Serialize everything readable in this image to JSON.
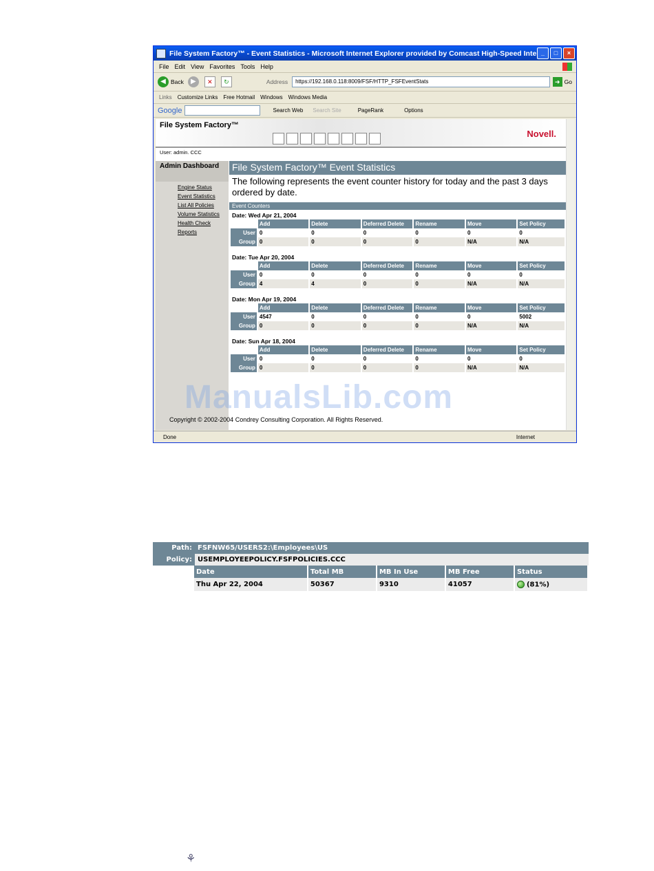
{
  "window": {
    "title": "File System Factory™ - Event Statistics - Microsoft Internet Explorer provided by Comcast High-Speed Internet",
    "menu": [
      "File",
      "Edit",
      "View",
      "Favorites",
      "Tools",
      "Help"
    ],
    "back_label": "Back",
    "address_label": "Address",
    "address_value": "https://192.168.0.118:8009/FSF/HTTP_FSFEventStats",
    "go_label": "Go",
    "links_label": "Links",
    "links": [
      "Customize Links",
      "Free Hotmail",
      "Windows",
      "Windows Media"
    ],
    "google_label": "Google",
    "google_items": [
      "Search Web",
      "Search Site",
      "PageRank",
      "Options"
    ],
    "status_left": "Done",
    "status_right": "Internet"
  },
  "app": {
    "header_title": "File System Factory™",
    "brand": "Novell.",
    "user_line": "User: admin. CCC",
    "side_title": "Admin Dashboard",
    "nav": [
      "Engine Status",
      "Event Statistics",
      "List All Policies",
      "Volume Statistics",
      "Health Check",
      "Reports"
    ],
    "page_title": "File System Factory™ Event Statistics",
    "page_desc": "The following represents the event counter history for today and the past 3 days ordered by date.",
    "section_label": "Event Counters",
    "columns": [
      "Add",
      "Delete",
      "Deferred Delete",
      "Rename",
      "Move",
      "Set Policy"
    ],
    "row_labels": [
      "User",
      "Group"
    ],
    "days": [
      {
        "date": "Date: Wed Apr 21, 2004",
        "user": [
          "0",
          "0",
          "0",
          "0",
          "0",
          "0"
        ],
        "group": [
          "0",
          "0",
          "0",
          "0",
          "N/A",
          "N/A"
        ]
      },
      {
        "date": "Date: Tue Apr 20, 2004",
        "user": [
          "0",
          "0",
          "0",
          "0",
          "0",
          "0"
        ],
        "group": [
          "4",
          "4",
          "0",
          "0",
          "N/A",
          "N/A"
        ]
      },
      {
        "date": "Date: Mon Apr 19, 2004",
        "user": [
          "4547",
          "0",
          "0",
          "0",
          "0",
          "5002"
        ],
        "group": [
          "0",
          "0",
          "0",
          "0",
          "N/A",
          "N/A"
        ]
      },
      {
        "date": "Date: Sun Apr 18, 2004",
        "user": [
          "0",
          "0",
          "0",
          "0",
          "0",
          "0"
        ],
        "group": [
          "0",
          "0",
          "0",
          "0",
          "N/A",
          "N/A"
        ]
      }
    ],
    "copyright": "Copyright © 2002-2004 Condrey Consulting Corporation. All Rights Reserved."
  },
  "volume": {
    "path_label": "Path:",
    "path_value": "FSFNW65/USERS2:\\Employees\\US",
    "policy_label": "Policy:",
    "policy_value": "USEMPLOYEEPOLICY.FSFPOLICIES.CCC",
    "headers": [
      "Date",
      "Total MB",
      "MB In Use",
      "MB Free",
      "Status"
    ],
    "row": [
      "Thu Apr 22, 2004",
      "50367",
      "9310",
      "41057",
      "(81%)"
    ]
  },
  "watermark": "ManualsLib.com"
}
